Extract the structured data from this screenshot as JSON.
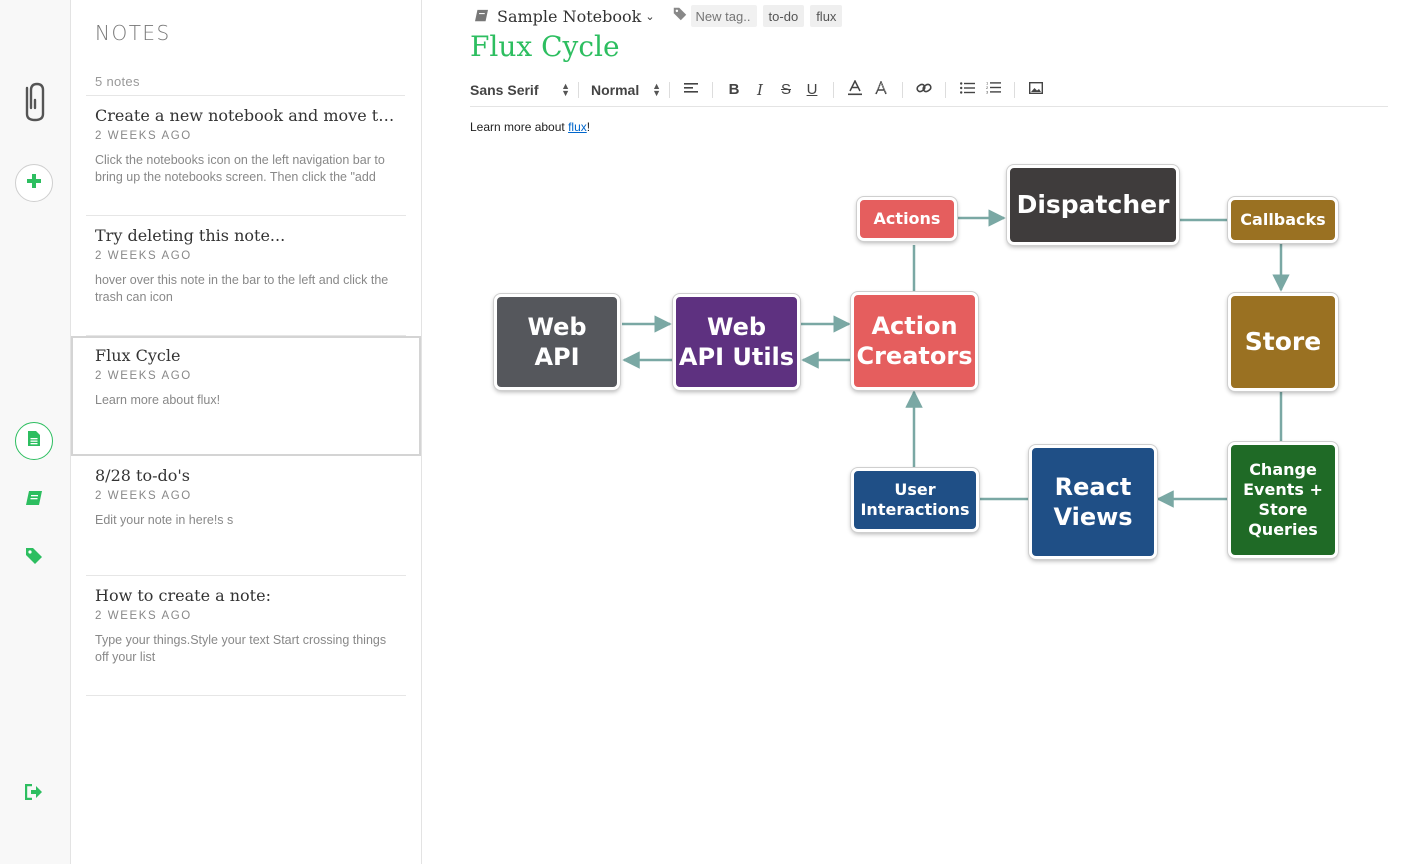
{
  "rail": {
    "logo_icon": "paperclip-logo-icon",
    "new_note_icon": "plus-icon",
    "notes_icon": "document-icon",
    "notebooks_icon": "book-icon",
    "tags_icon": "tag-icon",
    "logout_icon": "sign-out-icon",
    "accent_color": "#2dbe60"
  },
  "notes_panel": {
    "title": "NOTES",
    "count": "5 notes",
    "notes": [
      {
        "title": "Create a new notebook and move this note there",
        "date": "2 WEEKS AGO",
        "snippet": "Click the notebooks icon on the left navigation bar to bring up the notebooks screen. Then click the \"add notebook\" icon and type in a"
      },
      {
        "title": "Try deleting this note...",
        "date": "2 WEEKS AGO",
        "snippet": "hover over this note in the bar to the left and click the trash can icon"
      },
      {
        "title": "Flux Cycle",
        "date": "2 WEEKS AGO",
        "snippet": "Learn more about flux!"
      },
      {
        "title": "8/28 to-do's",
        "date": "2 WEEKS AGO",
        "snippet": "Edit your note in here!s s"
      },
      {
        "title": "How to create a note:",
        "date": "2 WEEKS AGO",
        "snippet": "Type your things.Style your text Start crossing things off your list"
      }
    ]
  },
  "editor": {
    "notebook": "Sample Notebook",
    "tag_placeholder": "New tag..",
    "tags": [
      "to-do",
      "flux"
    ],
    "title": "Flux Cycle",
    "toolbar": {
      "font": "Sans Serif",
      "size": "Normal",
      "bold": "B",
      "italic": "I",
      "strike": "S",
      "underline": "U"
    },
    "body_prefix": "Learn more about ",
    "body_link": "flux",
    "body_suffix": "!"
  },
  "diagram": {
    "web_api": "Web\nAPI",
    "web_api_utils": "Web\nAPI Utils",
    "action_creators": "Action\nCreators",
    "actions": "Actions",
    "dispatcher": "Dispatcher",
    "callbacks": "Callbacks",
    "store": "Store",
    "change_events": "Change\nEvents +\nStore\nQueries",
    "react_views": "React\nViews",
    "user_interactions": "User\nInteractions",
    "colors": {
      "web_api": "#55575c",
      "web_api_utils": "#5e3180",
      "action_creators": "#e55e5e",
      "dispatcher": "#3f3c3c",
      "callbacks": "#9a7122",
      "store": "#9a7122",
      "change_events": "#1f6a26",
      "react_views": "#1f4f86",
      "user_interactions": "#1f4f86",
      "arrow": "#7aa8a4"
    }
  }
}
